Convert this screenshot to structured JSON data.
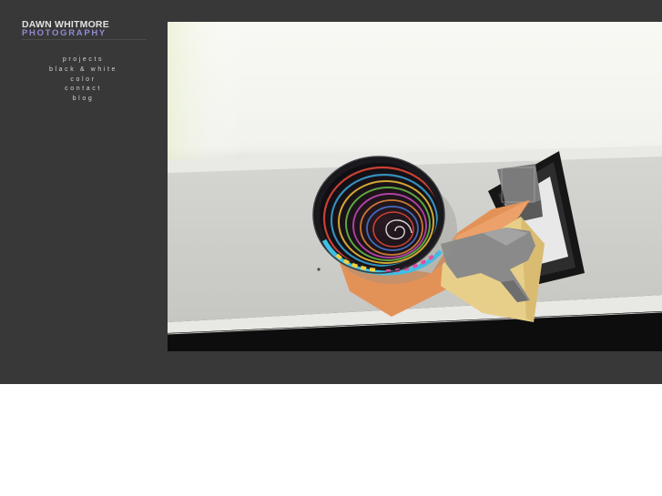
{
  "site": {
    "logo_line1": "DAWN WHITMORE",
    "logo_line2": "PHOTOGRAPHY",
    "logo_colors": {
      "line1": "#e2e2e2",
      "line2": "#8f8bd3"
    },
    "background": "#383838"
  },
  "nav": {
    "items": [
      {
        "label": "projects"
      },
      {
        "label": "black & white"
      },
      {
        "label": "color"
      },
      {
        "label": "contact"
      },
      {
        "label": "blog"
      }
    ]
  },
  "photo": {
    "subject": "collage-photograph"
  }
}
